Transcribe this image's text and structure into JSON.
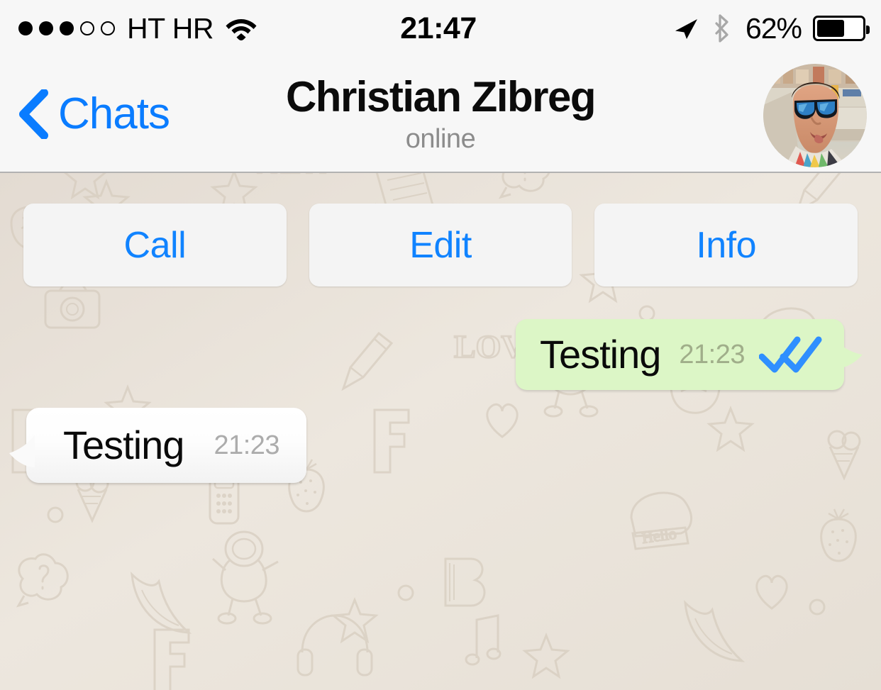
{
  "status_bar": {
    "signal_dots_filled": 3,
    "signal_dots_empty": 2,
    "carrier": "HT HR",
    "wifi_icon": "wifi-icon",
    "time": "21:47",
    "location_icon": "location-arrow-icon",
    "bluetooth_icon": "bluetooth-icon",
    "battery_percent": "62%",
    "battery_level": 62
  },
  "nav_bar": {
    "back_icon": "chevron-left-icon",
    "back_label": "Chats",
    "title": "Christian Zibreg",
    "subtitle": "online",
    "avatar_alt": "contact-avatar"
  },
  "actions": [
    {
      "label": "Call",
      "name": "call-button"
    },
    {
      "label": "Edit",
      "name": "edit-button"
    },
    {
      "label": "Info",
      "name": "info-button"
    }
  ],
  "messages": [
    {
      "direction": "outgoing",
      "text": "Testing",
      "time": "21:23",
      "status_icon": "double-check-icon",
      "read": true
    },
    {
      "direction": "incoming",
      "text": "Testing",
      "time": "21:23"
    }
  ],
  "colors": {
    "accent_blue": "#0A7CFF",
    "button_blue": "#1083FF",
    "bubble_out": "#DCF6C6",
    "bubble_in": "#FFFFFF",
    "wallpaper": "#E7E0D8",
    "nav_bg": "#F7F7F7",
    "check_blue": "#2F8FFF",
    "time_out": "#A0AE8A",
    "time_in": "#ACACAC",
    "subtitle_gray": "#8C8C8C"
  }
}
